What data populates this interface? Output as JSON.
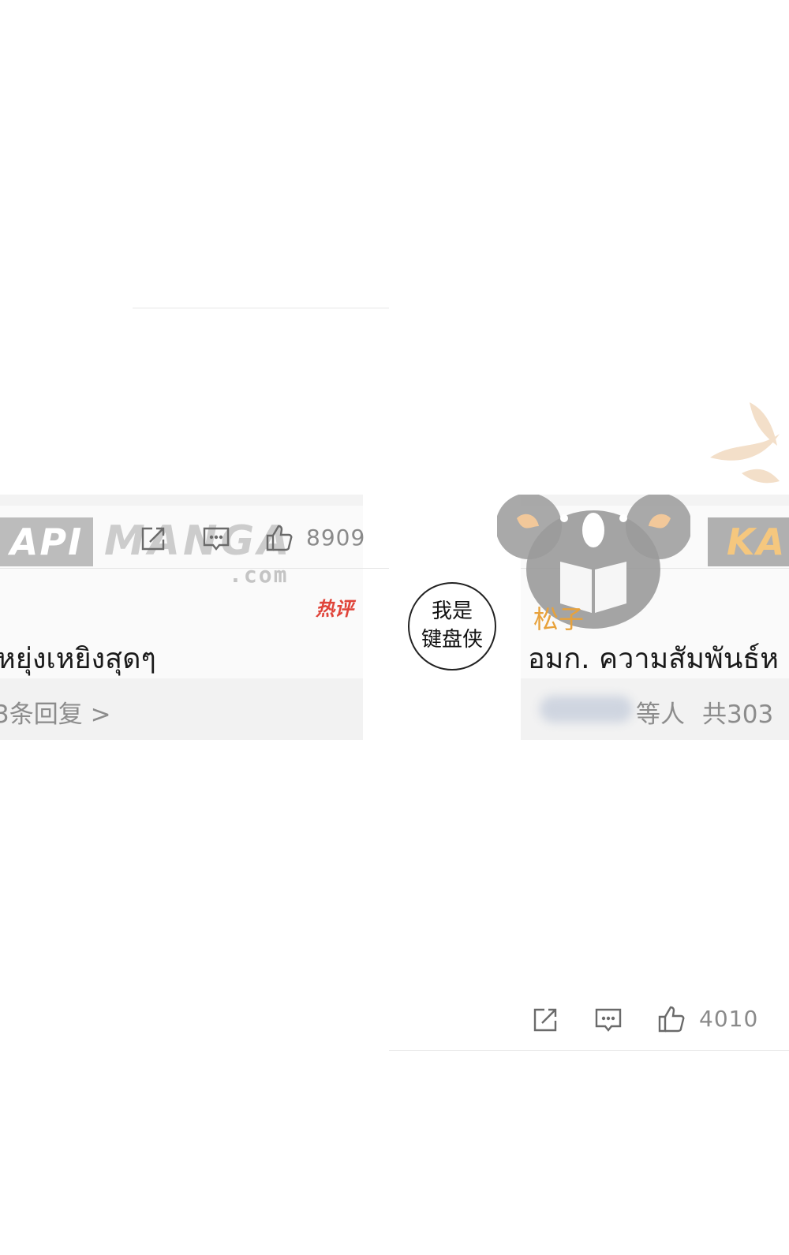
{
  "left_comment": {
    "share_icon": "share-icon",
    "comment_icon": "comment-icon",
    "like_icon": "thumbs-up-icon",
    "like_count": "8909",
    "hot_badge": "热评",
    "text": "หยุ่งเหยิงสุดๆ",
    "replies_link": "3条回复 >"
  },
  "middle": {
    "avatar_line1": "我是",
    "avatar_line2": "键盘侠"
  },
  "right_comment": {
    "username": "松子",
    "text": "อมก. ความสัมพันธ์ห",
    "repliers_suffix": "等人",
    "total_replies": "共303",
    "share_icon": "share-icon",
    "comment_icon": "comment-icon",
    "like_icon": "thumbs-up-icon",
    "like_count": "4010"
  },
  "watermark": {
    "left_box": "API",
    "manga": "MANGA",
    "dotcom": ".com",
    "right_box": "KA"
  },
  "colors": {
    "username": "#e8a23b",
    "hot_badge": "#e0443a",
    "muted_text": "#8c8c8c"
  }
}
